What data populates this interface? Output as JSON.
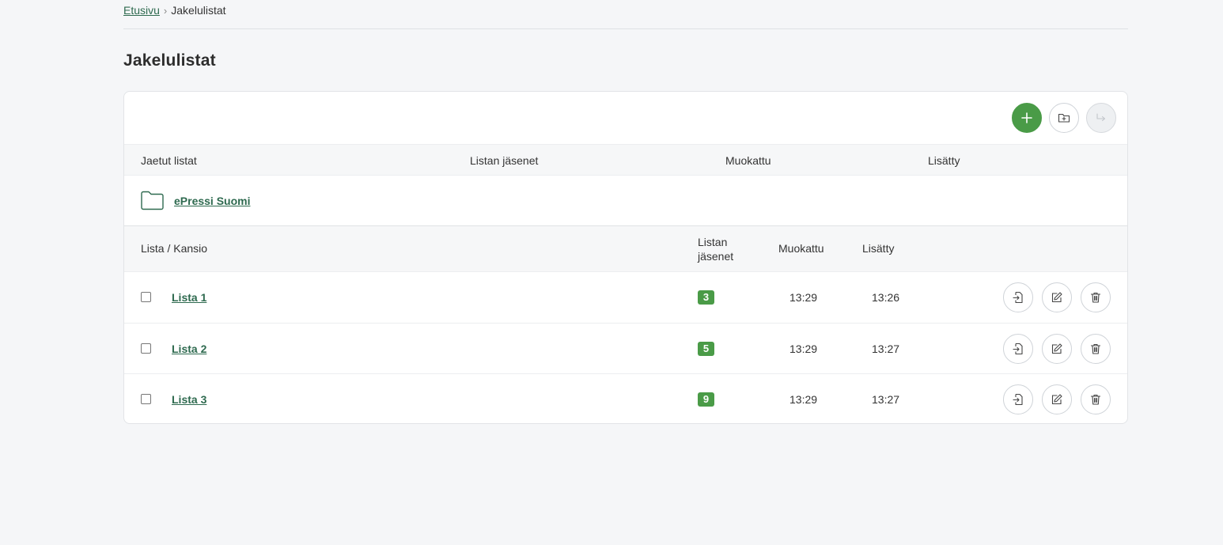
{
  "breadcrumb": {
    "home": "Etusivu",
    "separator": "›",
    "current": "Jakelulistat"
  },
  "page_title": "Jakelulistat",
  "shared_header": {
    "name": "Jaetut listat",
    "members": "Listan jäsenet",
    "modified": "Muokattu",
    "added": "Lisätty"
  },
  "shared_folders": [
    {
      "name": "ePressi Suomi",
      "icon": "folder-icon"
    }
  ],
  "list_header": {
    "name": "Lista / Kansio",
    "members_line1": "Listan",
    "members_line2": "jäsenet",
    "modified": "Muokattu",
    "added": "Lisätty"
  },
  "rows": [
    {
      "name": "Lista 1",
      "members": "3",
      "modified": "13:29",
      "added": "13:26"
    },
    {
      "name": "Lista 2",
      "members": "5",
      "modified": "13:29",
      "added": "13:27"
    },
    {
      "name": "Lista 3",
      "members": "9",
      "modified": "13:29",
      "added": "13:27"
    }
  ],
  "colors": {
    "accent": "#4a9b47",
    "link": "#2e6a4f",
    "background": "#f5f6f8"
  },
  "toolbar_icons": [
    "plus-icon",
    "folder-plus-icon",
    "move-arrow-icon"
  ],
  "row_action_icons": [
    "import-file-icon",
    "edit-icon",
    "trash-icon"
  ]
}
